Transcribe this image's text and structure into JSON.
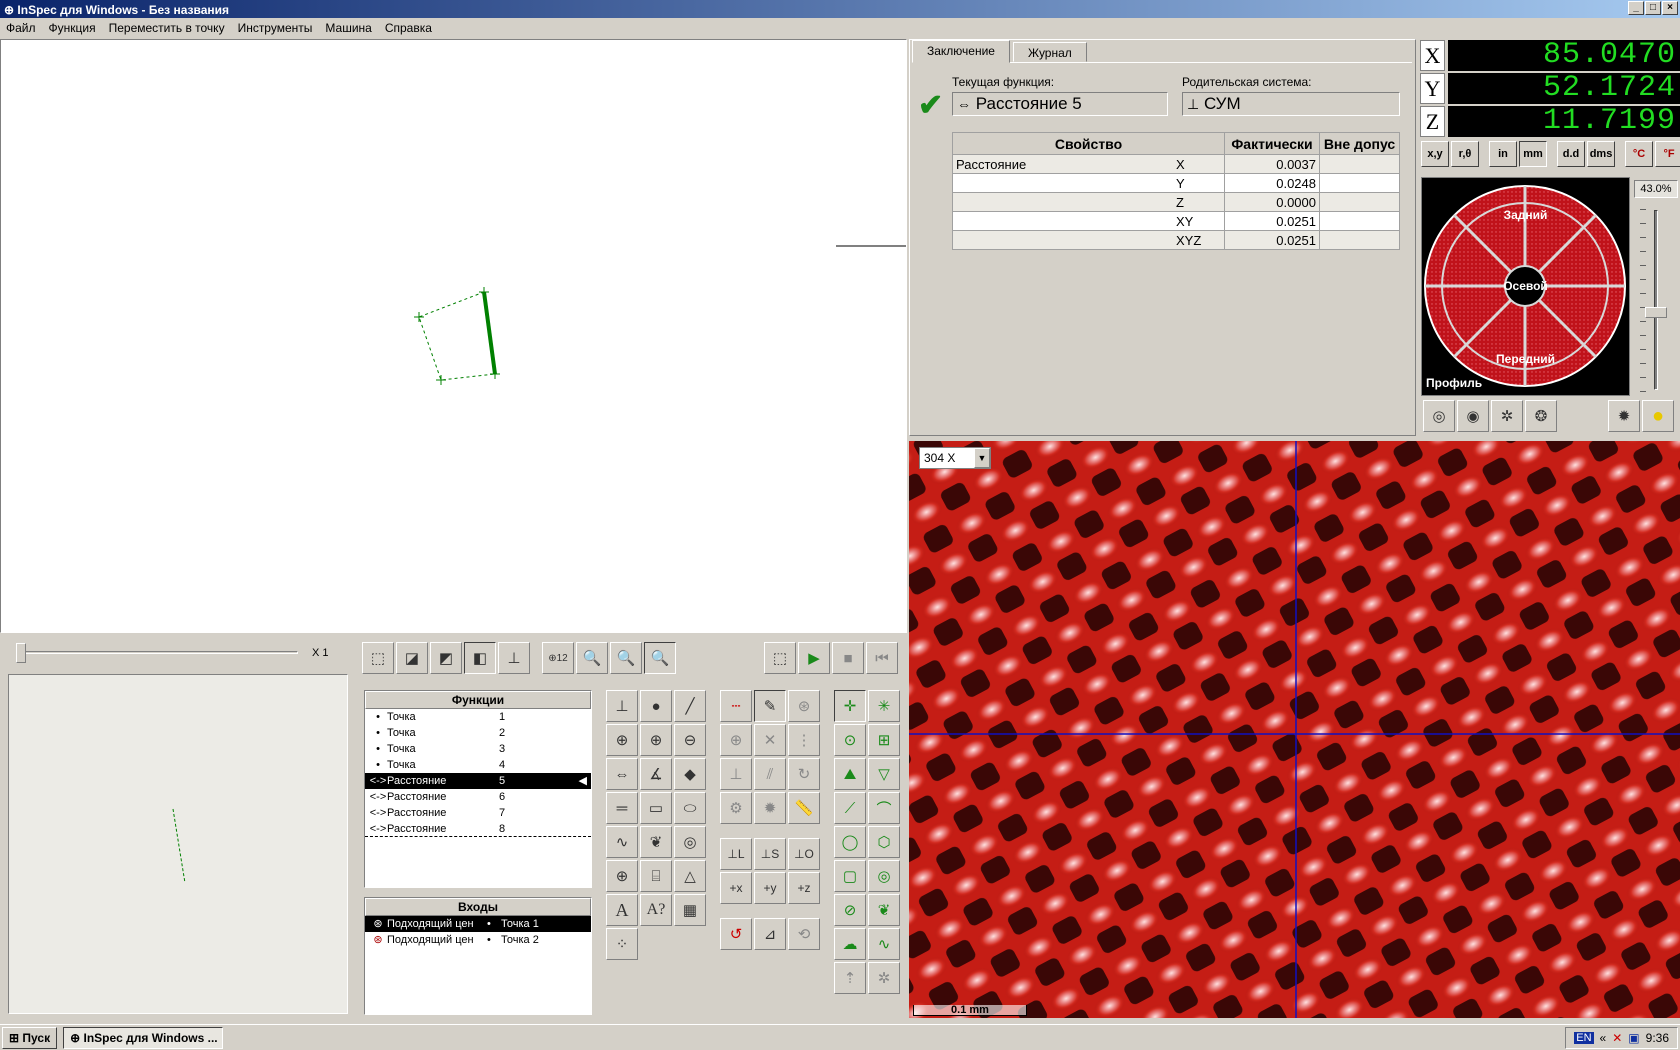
{
  "window": {
    "title": "InSpec для Windows - Без названия"
  },
  "menu": [
    "Файл",
    "Функция",
    "Переместить в точку",
    "Инструменты",
    "Машина",
    "Справка"
  ],
  "tabs": [
    "Заключение",
    "Журнал"
  ],
  "summary": {
    "current_function_label": "Текущая функция:",
    "current_function_value": "Расстояние  5",
    "parent_system_label": "Родительская система:",
    "parent_system_value": "СУМ",
    "columns": [
      "Свойство",
      "Фактически",
      "Вне допус"
    ],
    "rows": [
      {
        "property": "Расстояние",
        "axis": "X",
        "actual": "0.0037",
        "out": ""
      },
      {
        "property": "",
        "axis": "Y",
        "actual": "0.0248",
        "out": ""
      },
      {
        "property": "",
        "axis": "Z",
        "actual": "0.0000",
        "out": ""
      },
      {
        "property": "",
        "axis": "XY",
        "actual": "0.0251",
        "out": ""
      },
      {
        "property": "",
        "axis": "XYZ",
        "actual": "0.0251",
        "out": ""
      }
    ]
  },
  "dro": {
    "x_label": "X",
    "x_value": "85.0470",
    "y_label": "Y",
    "y_value": "52.1724",
    "z_label": "Z",
    "z_value": "11.7199"
  },
  "units": [
    "x,y",
    "r,θ",
    "in",
    "mm",
    "d.d",
    "dms",
    "°C",
    "°F"
  ],
  "light": {
    "back_label": "Задний",
    "axial_label": "Осевой",
    "front_label": "Передний",
    "profile_label": "Профиль",
    "percent": "43.0%",
    "level_fraction": 0.43
  },
  "zoom_slider": {
    "label": "X 1"
  },
  "functions": {
    "header": "Функции",
    "items": [
      {
        "icon": "•",
        "name": "Точка",
        "num": "1"
      },
      {
        "icon": "•",
        "name": "Точка",
        "num": "2"
      },
      {
        "icon": "•",
        "name": "Точка",
        "num": "3"
      },
      {
        "icon": "•",
        "name": "Точка",
        "num": "4"
      },
      {
        "icon": "<->",
        "name": "Расстояние",
        "num": "5"
      },
      {
        "icon": "<->",
        "name": "Расстояние",
        "num": "6"
      },
      {
        "icon": "<->",
        "name": "Расстояние",
        "num": "7"
      },
      {
        "icon": "<->",
        "name": "Расстояние",
        "num": "8"
      }
    ]
  },
  "inputs": {
    "header": "Входы",
    "items": [
      {
        "name": "Подходящий цен",
        "ref": "Точка  1"
      },
      {
        "name": "Подходящий цен",
        "ref": "Точка  2"
      }
    ]
  },
  "camera": {
    "magnification": "304 X",
    "scale": "0.1 mm"
  },
  "taskbar": {
    "start": "Пуск",
    "task": "InSpec для Windows ...",
    "lang": "EN",
    "time": "9:36"
  },
  "colors": {
    "dro_bg": "#000000",
    "dro_text": "#22dd22",
    "title_bar": "#0a246a",
    "light_ring": "#c0121a",
    "geometry": "#008000"
  }
}
